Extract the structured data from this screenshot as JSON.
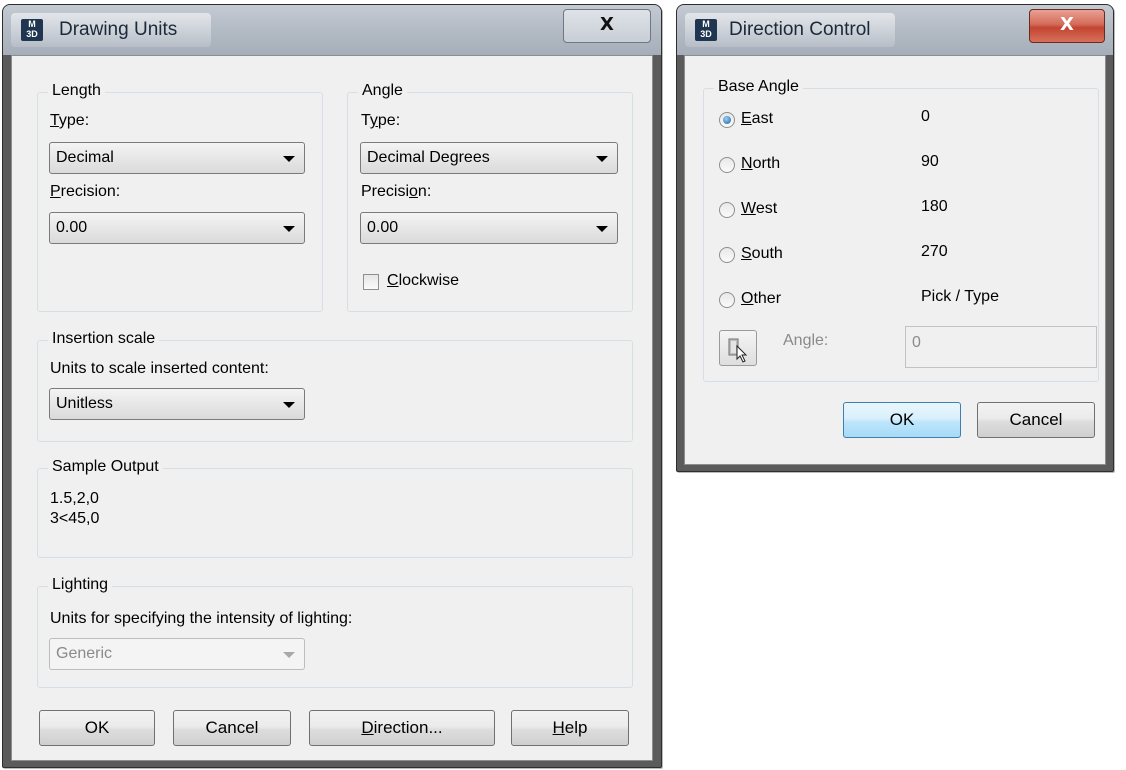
{
  "drawing_units": {
    "title": "Drawing Units",
    "app_icon": [
      "M",
      "3D"
    ],
    "close_glyph": "X",
    "length": {
      "group_label": "Length",
      "type_label_first": "T",
      "type_label_rest": "ype:",
      "type_value": "Decimal",
      "precision_label_first": "P",
      "precision_label_rest": "recision:",
      "precision_value": "0.00"
    },
    "angle": {
      "group_label": "Angle",
      "type_label_pre": "T",
      "type_label_u": "y",
      "type_label_post": "pe:",
      "type_value": "Decimal Degrees",
      "precision_label_pre": "Precisi",
      "precision_label_u": "o",
      "precision_label_post": "n:",
      "precision_value": "0.00",
      "clockwise_first": "C",
      "clockwise_rest": "lockwise"
    },
    "insertion": {
      "group_label": "Insertion scale",
      "description": "Units to scale inserted content:",
      "value": "Unitless"
    },
    "sample": {
      "group_label": "Sample Output",
      "line1": "1.5,2,0",
      "line2": "3<45,0"
    },
    "lighting": {
      "group_label": "Lighting",
      "description": "Units for specifying the intensity of lighting:",
      "value": "Generic"
    },
    "buttons": {
      "ok": "OK",
      "cancel": "Cancel",
      "direction_first": "D",
      "direction_rest": "irection...",
      "help_first": "H",
      "help_rest": "elp"
    }
  },
  "direction_control": {
    "title": "Direction Control",
    "app_icon": [
      "M",
      "3D"
    ],
    "close_glyph": "X",
    "group_label": "Base Angle",
    "options": [
      {
        "first": "E",
        "rest": "ast",
        "value": "0",
        "checked": true
      },
      {
        "first": "N",
        "rest": "orth",
        "value": "90",
        "checked": false
      },
      {
        "first": "W",
        "rest": "est",
        "value": "180",
        "checked": false
      },
      {
        "first": "S",
        "rest": "outh",
        "value": "270",
        "checked": false
      },
      {
        "first": "O",
        "rest": "ther",
        "value": "Pick / Type",
        "checked": false
      }
    ],
    "angle_label": "Angle:",
    "angle_value": "0",
    "ok": "OK",
    "cancel": "Cancel"
  },
  "colors": {
    "close_red": "#c75050",
    "frame_dark": "#5b5b5b",
    "client_bg": "#f0f0f0",
    "default_button_border": "#3c7fb1"
  }
}
